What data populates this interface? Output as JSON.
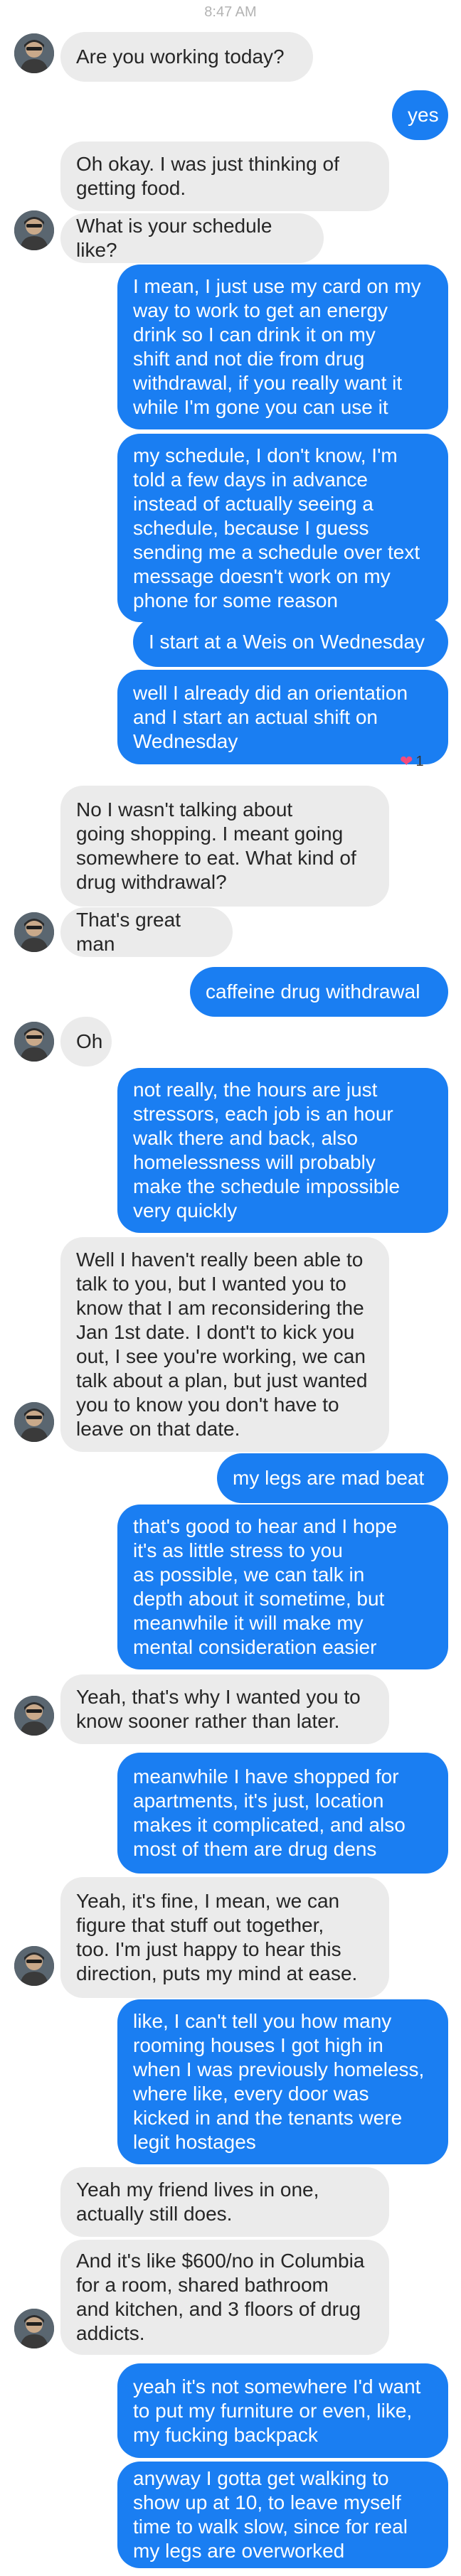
{
  "status_bar": {
    "time": "8:47 AM"
  },
  "messages": [
    {
      "dir": "in",
      "text": "Are you working today?"
    },
    {
      "dir": "out",
      "text": "yes"
    },
    {
      "dir": "in",
      "text": "Oh okay. I was just thinking of\ngetting food."
    },
    {
      "dir": "in",
      "text": "What is your schedule like?"
    },
    {
      "dir": "out",
      "text": "I mean, I just use my card on my\nway to work to get an energy\ndrink so I can drink it on my\nshift and not die from drug\nwithdrawal, if you really want it\nwhile I'm gone you can use it"
    },
    {
      "dir": "out",
      "text": "my schedule, I don't know, I'm\ntold a few days in advance\ninstead of actually seeing a\nschedule, because I guess\nsending me a schedule over text\nmessage doesn't work on my\nphone for some reason"
    },
    {
      "dir": "out",
      "text": "I start at a Weis on Wednesday"
    },
    {
      "dir": "out",
      "text": "well I already did an orientation\nand I start an actual shift on\nWednesday"
    },
    {
      "dir": "in",
      "text": "No I wasn't talking about\ngoing shopping. I meant going\nsomewhere to eat. What kind of\ndrug withdrawal?"
    },
    {
      "dir": "in",
      "text": "That's great man"
    },
    {
      "dir": "out",
      "text": "caffeine drug withdrawal"
    },
    {
      "dir": "in",
      "text": "Oh"
    },
    {
      "dir": "out",
      "text": "not really, the hours are just\nstressors, each job is an hour\nwalk there and back, also\nhomelessness will probably\nmake the schedule impossible\nvery quickly"
    },
    {
      "dir": "in",
      "text": "Well I haven't really been able to\ntalk to you, but I wanted you to\nknow that I am reconsidering the\nJan 1st date. I dont't to kick you\nout, I see you're working, we can\ntalk about a plan, but just wanted\nyou to know you don't have to\nleave on that date."
    },
    {
      "dir": "out",
      "text": "my legs are mad beat"
    },
    {
      "dir": "out",
      "text": "that's good to hear and I hope\nit's as little stress to you\nas possible, we can talk in\ndepth about it sometime, but\nmeanwhile it will make my\nmental consideration easier"
    },
    {
      "dir": "in",
      "text": "Yeah, that's why I wanted you to\nknow sooner rather than later."
    },
    {
      "dir": "out",
      "text": "meanwhile I have shopped for\napartments, it's just, location\nmakes it complicated, and also\nmost of them are drug dens"
    },
    {
      "dir": "in",
      "text": "Yeah, it's fine, I mean, we can\nfigure that stuff out together,\ntoo. I'm just happy to hear this\ndirection, puts my mind at ease."
    },
    {
      "dir": "out",
      "text": "like, I can't tell you how many\nrooming houses I got high in\nwhen I was previously homeless,\nwhere like, every door was\nkicked in and the tenants were\nlegit hostages"
    },
    {
      "dir": "in",
      "text": "Yeah my friend lives in one,\nactually still does."
    },
    {
      "dir": "in",
      "text": "And it's like $600/no in Columbia\nfor a room, shared bathroom\nand kitchen, and 3 floors of drug\naddicts."
    },
    {
      "dir": "out",
      "text": "yeah it's not somewhere I'd want\nto put my furniture or even, like,\nmy fucking backpack"
    },
    {
      "dir": "out",
      "text": "anyway I gotta get walking to\nshow up at 10, to leave myself\ntime to walk slow, since for real\nmy legs are overworked"
    }
  ],
  "reaction": {
    "icon": "heart-icon",
    "count": "1",
    "color": "#f24b7d"
  },
  "colors": {
    "incoming": "#ebebeb",
    "outgoing": "#1a7ef2",
    "timestamp": "#b3b3b3"
  }
}
